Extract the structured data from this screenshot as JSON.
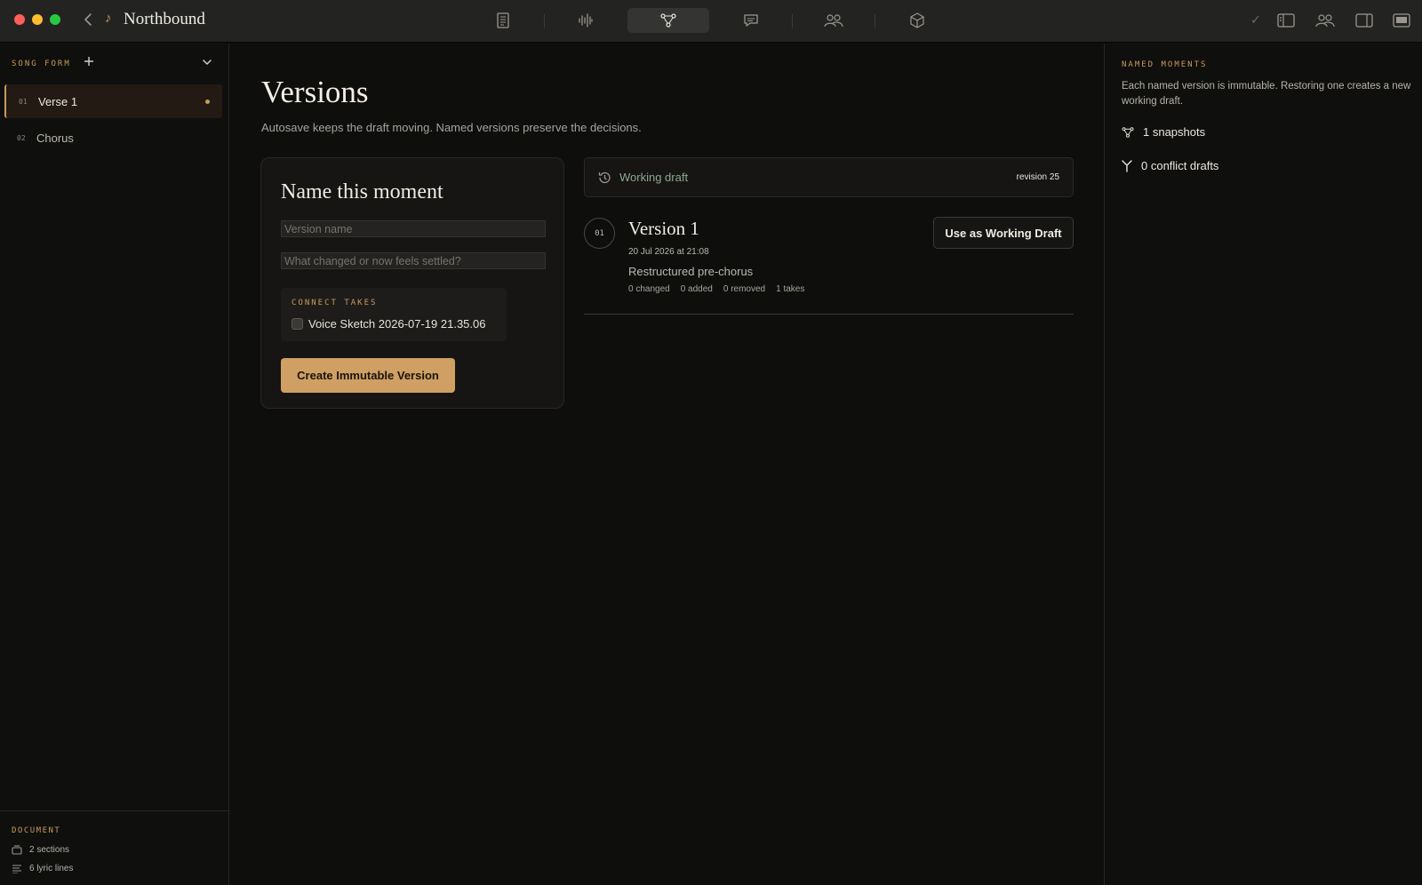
{
  "window": {
    "title": "Northbound"
  },
  "sidebar": {
    "heading": "SONG FORM",
    "items": [
      {
        "num": "01",
        "label": "Verse 1"
      },
      {
        "num": "02",
        "label": "Chorus"
      }
    ],
    "document": {
      "heading": "DOCUMENT",
      "sections": "2 sections",
      "lyric_lines": "6 lyric lines"
    }
  },
  "main": {
    "title": "Versions",
    "subtitle": "Autosave keeps the draft moving. Named versions preserve the decisions.",
    "name_card": {
      "title": "Name this moment",
      "name_placeholder": "Version name",
      "note_placeholder": "What changed or now feels settled?",
      "takes_heading": "CONNECT TAKES",
      "take_label": "Voice Sketch 2026-07-19 21.35.06",
      "create_button": "Create Immutable Version"
    },
    "working_draft": {
      "label": "Working draft",
      "revision": "revision 25"
    },
    "versions": [
      {
        "num": "01",
        "title": "Version 1",
        "date": "20 Jul 2026 at 21:08",
        "description": "Restructured pre-chorus",
        "stats": [
          "0 changed",
          "0 added",
          "0 removed",
          "1 takes"
        ],
        "button": "Use as Working Draft"
      }
    ]
  },
  "right_panel": {
    "heading": "NAMED MOMENTS",
    "text": "Each named version is immutable. Restoring one creates a new working draft.",
    "snapshots": "1 snapshots",
    "conflicts": "0 conflict drafts"
  },
  "colors": {
    "accent": "#c99a5a",
    "button": "#cf9f63",
    "background": "#0e0e0d",
    "titlebar": "#232322",
    "draft_green": "#8fa78c"
  }
}
